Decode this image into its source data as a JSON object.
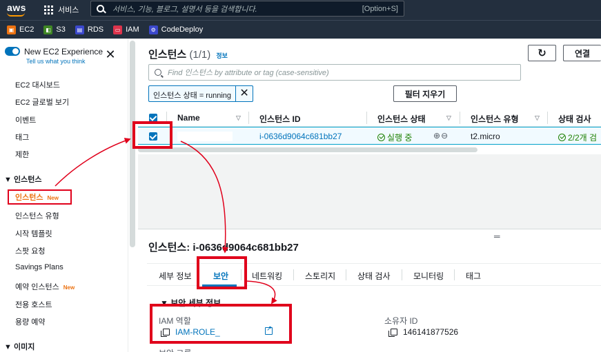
{
  "topnav": {
    "logo": "aws",
    "services_label": "서비스",
    "search_placeholder": "서비스, 기능, 블로그, 설명서 등을 검색합니다.",
    "search_shortcut": "[Option+S]"
  },
  "favorites": [
    {
      "label": "EC2",
      "color": "#ec7211",
      "icon": "ec2-icon"
    },
    {
      "label": "S3",
      "color": "#3f8624",
      "icon": "s3-icon"
    },
    {
      "label": "RDS",
      "color": "#3b48cc",
      "icon": "rds-icon"
    },
    {
      "label": "IAM",
      "color": "#dd344c",
      "icon": "iam-icon"
    },
    {
      "label": "CodeDeploy",
      "color": "#3b48cc",
      "icon": "codedeploy-icon"
    }
  ],
  "sidebar": {
    "new_experience": "New EC2 Experience",
    "tell_us": "Tell us what you think",
    "items_top": [
      "EC2 대시보드",
      "EC2 글로벌 보기",
      "이벤트",
      "태그",
      "제한"
    ],
    "section_instances": "인스턴스",
    "instances_items": [
      "인스턴스",
      "인스턴스 유형",
      "시작 템플릿",
      "스팟 요청",
      "Savings Plans",
      "예약 인스턴스",
      "전용 호스트",
      "용량 예약"
    ],
    "new_badge": "New",
    "section_images": "이미지"
  },
  "main": {
    "title": "인스턴스",
    "count": "(1/1)",
    "info": "정보",
    "refresh_icon": "refresh-icon",
    "connect_label": "연결",
    "filter_placeholder": "Find 인스턴스 by attribute or tag (case-sensitive)",
    "token_label": "인스턴스 상태 = running",
    "clear_filters": "필터 지우기"
  },
  "table": {
    "headers": [
      "Name",
      "인스턴스 ID",
      "인스턴스 상태",
      "인스턴스 유형",
      "상태 검사"
    ],
    "row": {
      "name": "",
      "instance_id": "i-0636d9064c681bb27",
      "state": "실행 중",
      "type": "t2.micro",
      "status_check": "2/2개 검"
    }
  },
  "detail": {
    "title": "인스턴스: i-0636d9064c681bb27",
    "tabs": [
      "세부 정보",
      "보안",
      "네트워킹",
      "스토리지",
      "상태 검사",
      "모니터링",
      "태그"
    ],
    "active_tab": "보안",
    "section": "보안 세부 정보",
    "iam_role_label": "IAM 역할",
    "iam_role_value": "IAM-ROLE_",
    "owner_label": "소유자 ID",
    "owner_value": "146141877526",
    "cutoff_label": "보안 그룹"
  },
  "colors": {
    "annotation_red": "#e0001b",
    "link_blue": "#0073bb",
    "accent_orange": "#ec7211"
  }
}
